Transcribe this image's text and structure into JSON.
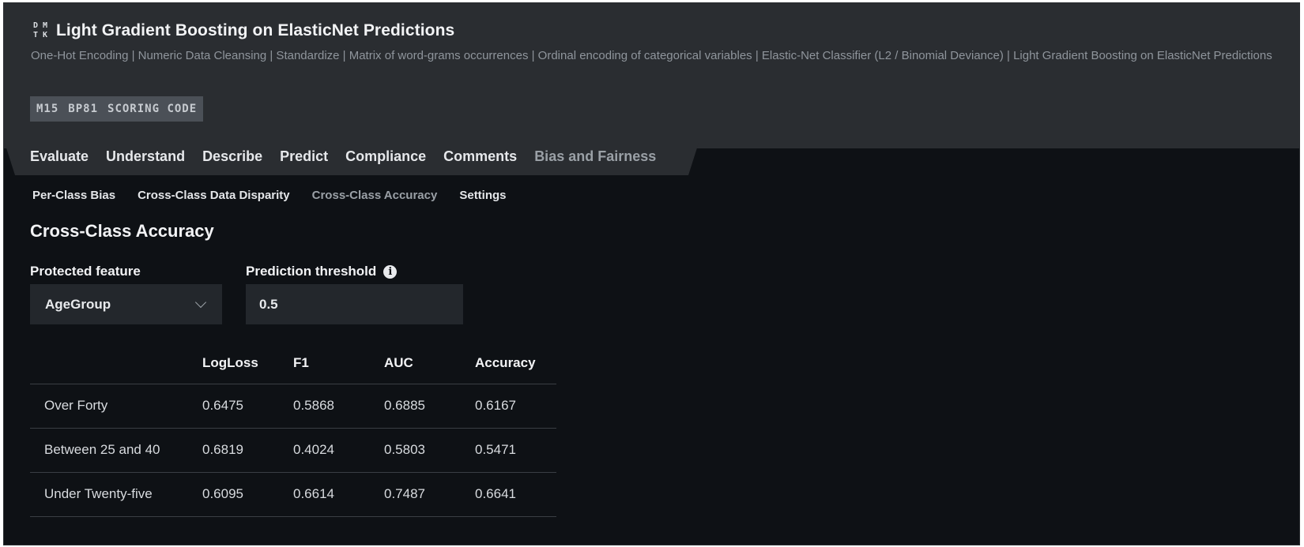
{
  "header": {
    "logo_glyphs": [
      "D",
      "M",
      "T",
      "K"
    ],
    "title": "Light Gradient Boosting on ElasticNet Predictions",
    "subtitle": "One-Hot Encoding | Numeric Data Cleansing | Standardize | Matrix of word-grams occurrences | Ordinal encoding of categorical variables | Elastic-Net Classifier (L2 / Binomial Deviance) | Light Gradient Boosting on ElasticNet Predictions",
    "badges": [
      "M15",
      "BP81",
      "SCORING CODE"
    ]
  },
  "tabs": [
    {
      "label": "Evaluate"
    },
    {
      "label": "Understand"
    },
    {
      "label": "Describe"
    },
    {
      "label": "Predict"
    },
    {
      "label": "Compliance"
    },
    {
      "label": "Comments"
    },
    {
      "label": "Bias and Fairness",
      "active": true
    }
  ],
  "subtabs": [
    {
      "label": "Per-Class Bias"
    },
    {
      "label": "Cross-Class Data Disparity"
    },
    {
      "label": "Cross-Class Accuracy",
      "active": true
    },
    {
      "label": "Settings"
    }
  ],
  "section": {
    "title": "Cross-Class Accuracy",
    "protected_feature_label": "Protected feature",
    "protected_feature_value": "AgeGroup",
    "threshold_label": "Prediction threshold",
    "threshold_value": "0.5",
    "info_icon": "i"
  },
  "table": {
    "columns": [
      "",
      "LogLoss",
      "F1",
      "AUC",
      "Accuracy"
    ],
    "rows": [
      [
        "Over Forty",
        "0.6475",
        "0.5868",
        "0.6885",
        "0.6167"
      ],
      [
        "Between 25 and 40",
        "0.6819",
        "0.4024",
        "0.5803",
        "0.5471"
      ],
      [
        "Under Twenty-five",
        "0.6095",
        "0.6614",
        "0.7487",
        "0.6641"
      ]
    ]
  }
}
